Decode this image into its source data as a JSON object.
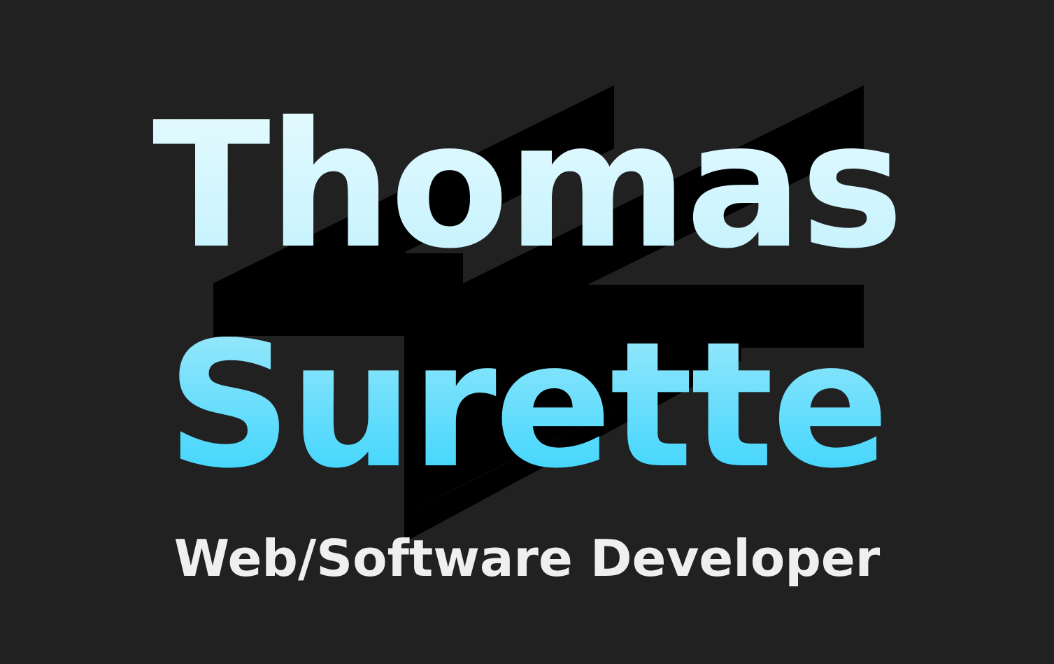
{
  "name": {
    "first": "Thomas",
    "last": "Surette"
  },
  "tagline": "Web/Software Developer",
  "colors": {
    "background": "#212121",
    "logo_mark": "#000000",
    "gradient_top": "#e6fbff",
    "gradient_bottom": "#1fcdfc",
    "tagline": "#efefef"
  },
  "icons": {
    "logo": "ts-monogram-logo"
  }
}
